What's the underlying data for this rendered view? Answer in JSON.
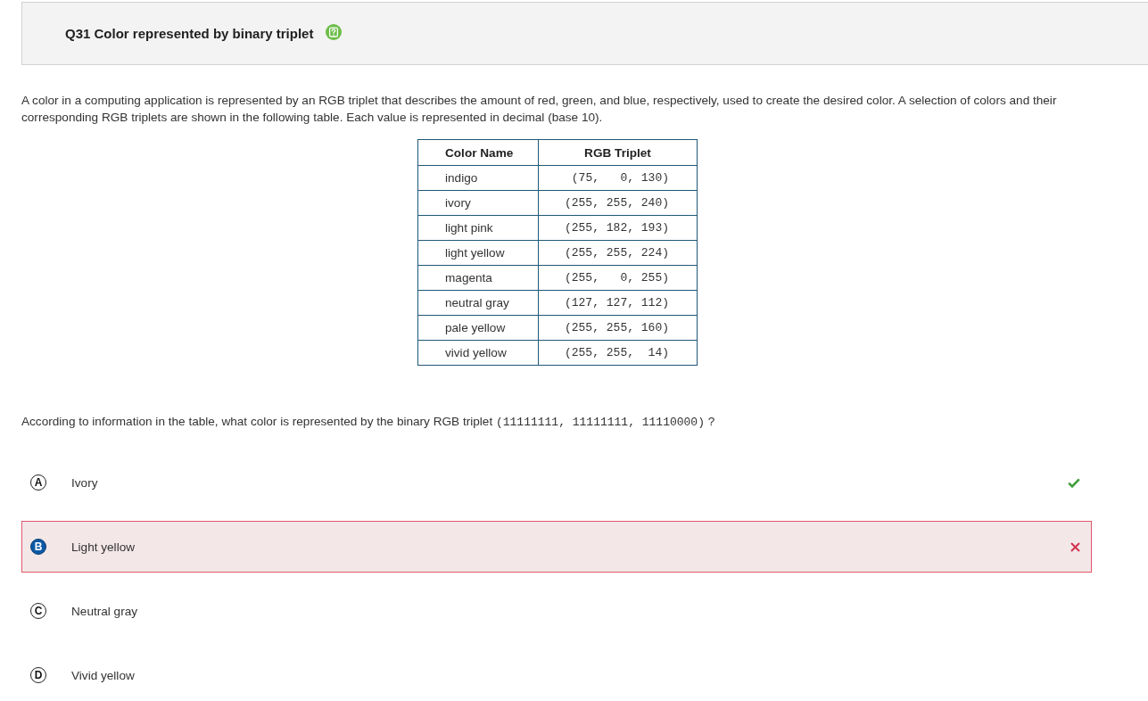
{
  "header": {
    "title": "Q31 Color represented by binary triplet"
  },
  "stem": "A color in a computing application is represented by an RGB triplet that describes the amount of red, green, and blue, respectively, used to create the desired color. A selection of colors and their corresponding RGB triplets are shown in the following table. Each value is represented in decimal (base 10).",
  "table": {
    "columns": [
      "Color Name",
      "RGB Triplet"
    ],
    "rows": [
      [
        "indigo",
        "(75,   0, 130)"
      ],
      [
        "ivory",
        "(255, 255, 240)"
      ],
      [
        "light pink",
        "(255, 182, 193)"
      ],
      [
        "light yellow",
        "(255, 255, 224)"
      ],
      [
        "magenta",
        "(255,   0, 255)"
      ],
      [
        "neutral gray",
        "(127, 127, 112)"
      ],
      [
        "pale yellow",
        "(255, 255, 160)"
      ],
      [
        "vivid yellow",
        "(255, 255,  14)"
      ]
    ]
  },
  "question": [
    {
      "kind": "text",
      "text": "According to information in the table, what color is represented by the binary RGB triplet "
    },
    {
      "kind": "code",
      "text": "(11111111, 11111111, 11110000)"
    },
    {
      "kind": "text",
      "text": " ?"
    }
  ],
  "options": [
    {
      "letter": "A",
      "text": "Ivory",
      "selected": false,
      "correct": true
    },
    {
      "letter": "B",
      "text": "Light yellow",
      "selected": true,
      "correct": false
    },
    {
      "letter": "C",
      "text": "Neutral gray",
      "selected": false,
      "correct": false
    },
    {
      "letter": "D",
      "text": "Vivid yellow",
      "selected": false,
      "correct": false
    }
  ]
}
